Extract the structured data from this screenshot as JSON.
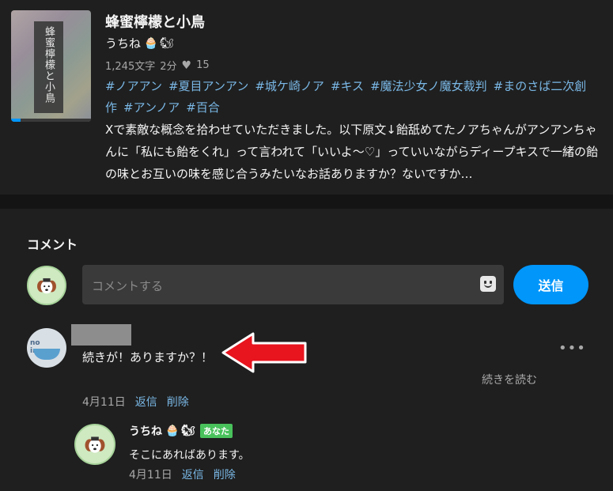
{
  "work": {
    "cover_title": "蜂蜜檸檬と小鳥",
    "title": "蜂蜜檸檬と小鳥",
    "author": "うちね",
    "author_emojis": [
      "🧁",
      "🐿"
    ],
    "char_count": "1,245文字",
    "read_time": "2分",
    "likes": "15",
    "tags": [
      "#ノアアン",
      "#夏目アンアン",
      "#城ケ崎ノア",
      "#キス",
      "#魔法少女ノ魔女裁判",
      "#まのさば二次創作",
      "#アンノア",
      "#百合"
    ],
    "caption": "Xで素敵な概念を拾わせていただきました。以下原文↓飴舐めてたノアちゃんがアンアンちゃんに「私にも飴をくれ」って言われて「いいよ～♡」っていいながらディープキスで一緒の飴の味とお互いの味を感じ合うみたいなお話ありますか？ないですか…",
    "read_progress": 0.12
  },
  "comments": {
    "heading": "コメント",
    "input_placeholder": "コメントする",
    "send_label": "送信",
    "first": {
      "avatar_text": "no image",
      "text": "続きが！ありますか？！",
      "read_more": "続きを読む",
      "date": "4月11日",
      "reply_label": "返信",
      "delete_label": "削除"
    },
    "reply": {
      "author": "うちね",
      "author_emojis": [
        "🧁",
        "🐿"
      ],
      "badge": "あなた",
      "text": "そこにあればあります。",
      "date": "4月11日",
      "reply_label": "返信",
      "delete_label": "削除"
    }
  },
  "colors": {
    "background": "#1f1f1f",
    "accent": "#0096fa",
    "tag": "#7ab8e6",
    "badge": "#49c25c",
    "arrow": "#e8141e"
  },
  "icons": [
    "heart-icon",
    "emoji-icon",
    "more-options-icon",
    "annotation-arrow"
  ]
}
